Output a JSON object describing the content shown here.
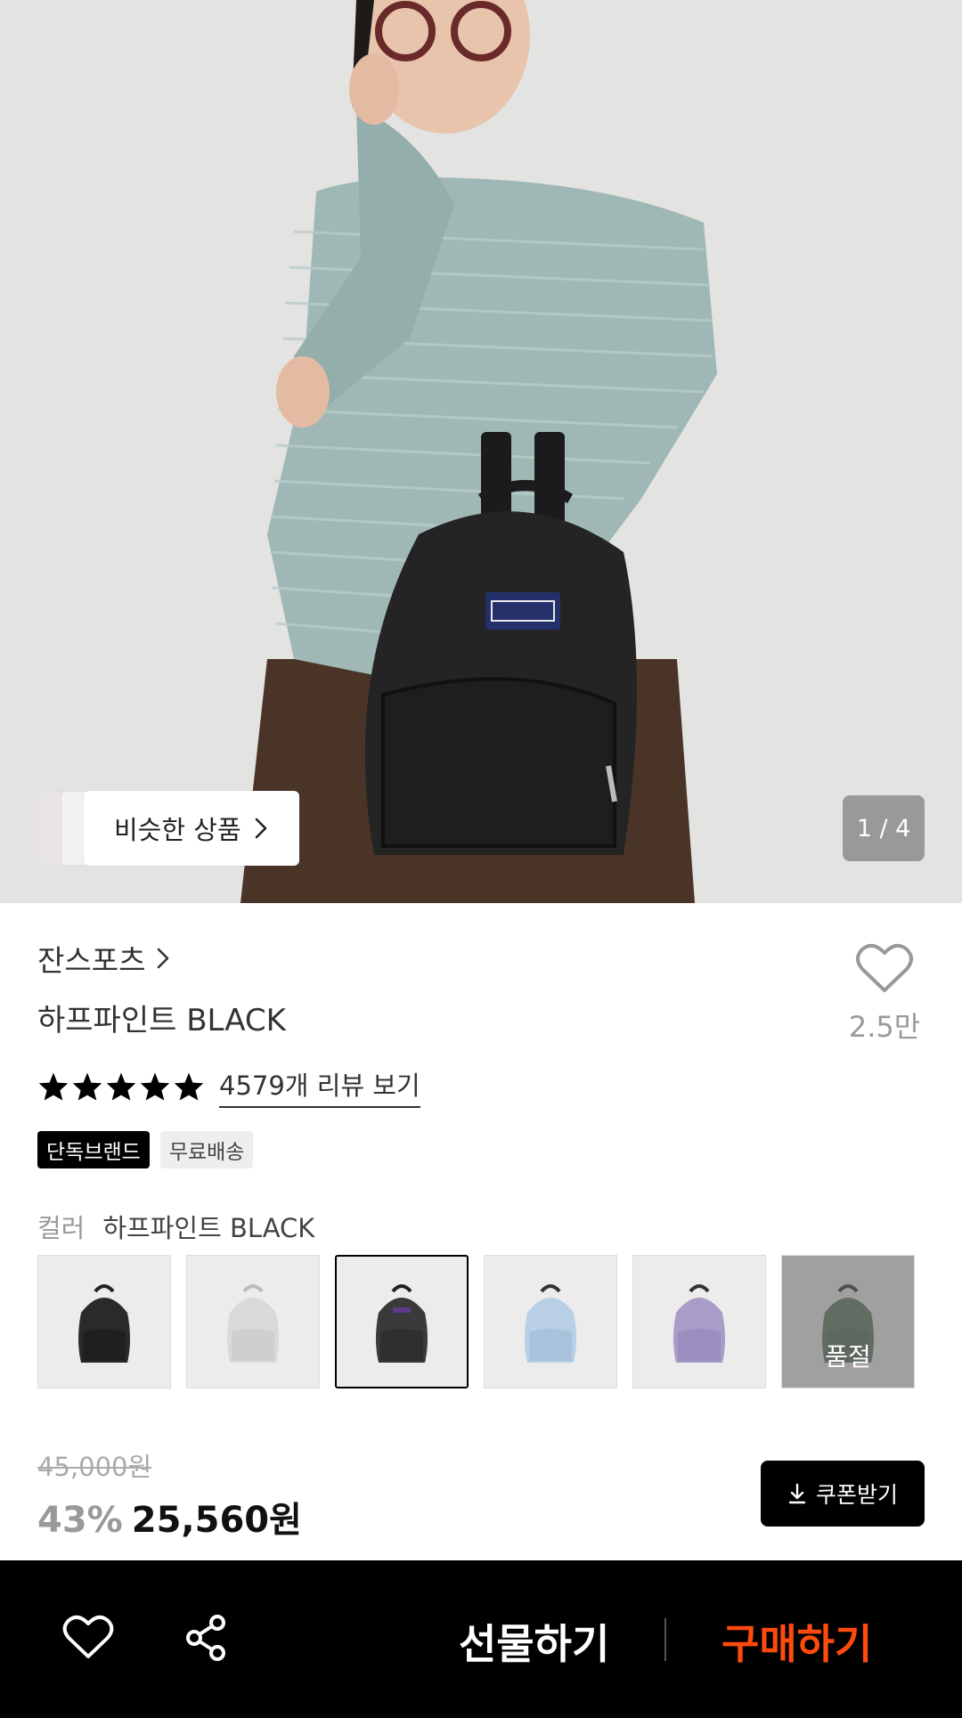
{
  "hero": {
    "similar_label": "비슷한 상품",
    "counter": "1 / 4"
  },
  "product": {
    "brand": "잔스포츠",
    "name": "하프파인트 BLACK",
    "like_count": "2.5만",
    "rating_stars": 5,
    "review_link": "4579개 리뷰 보기",
    "badges": [
      "단독브랜드",
      "무료배송"
    ],
    "color_label": "컬러",
    "color_value": "하프파인트 BLACK",
    "swatches": [
      {
        "color": "#2a2a2a",
        "selected": false,
        "soldout": false
      },
      {
        "color": "#d9d9d9",
        "selected": false,
        "soldout": false
      },
      {
        "color": "#3a3a3a",
        "selected": true,
        "soldout": false
      },
      {
        "color": "#b8cfe6",
        "selected": false,
        "soldout": false
      },
      {
        "color": "#a99cc8",
        "selected": false,
        "soldout": false
      },
      {
        "color": "#4f6b53",
        "selected": false,
        "soldout": true
      }
    ],
    "soldout_label": "품절",
    "original_price": "45,000원",
    "discount": "43%",
    "price": "25,560원",
    "coupon_label": "쿠폰받기"
  },
  "bottom_bar": {
    "gift_label": "선물하기",
    "buy_label": "구매하기",
    "buy_color": "#ff4a0e"
  }
}
